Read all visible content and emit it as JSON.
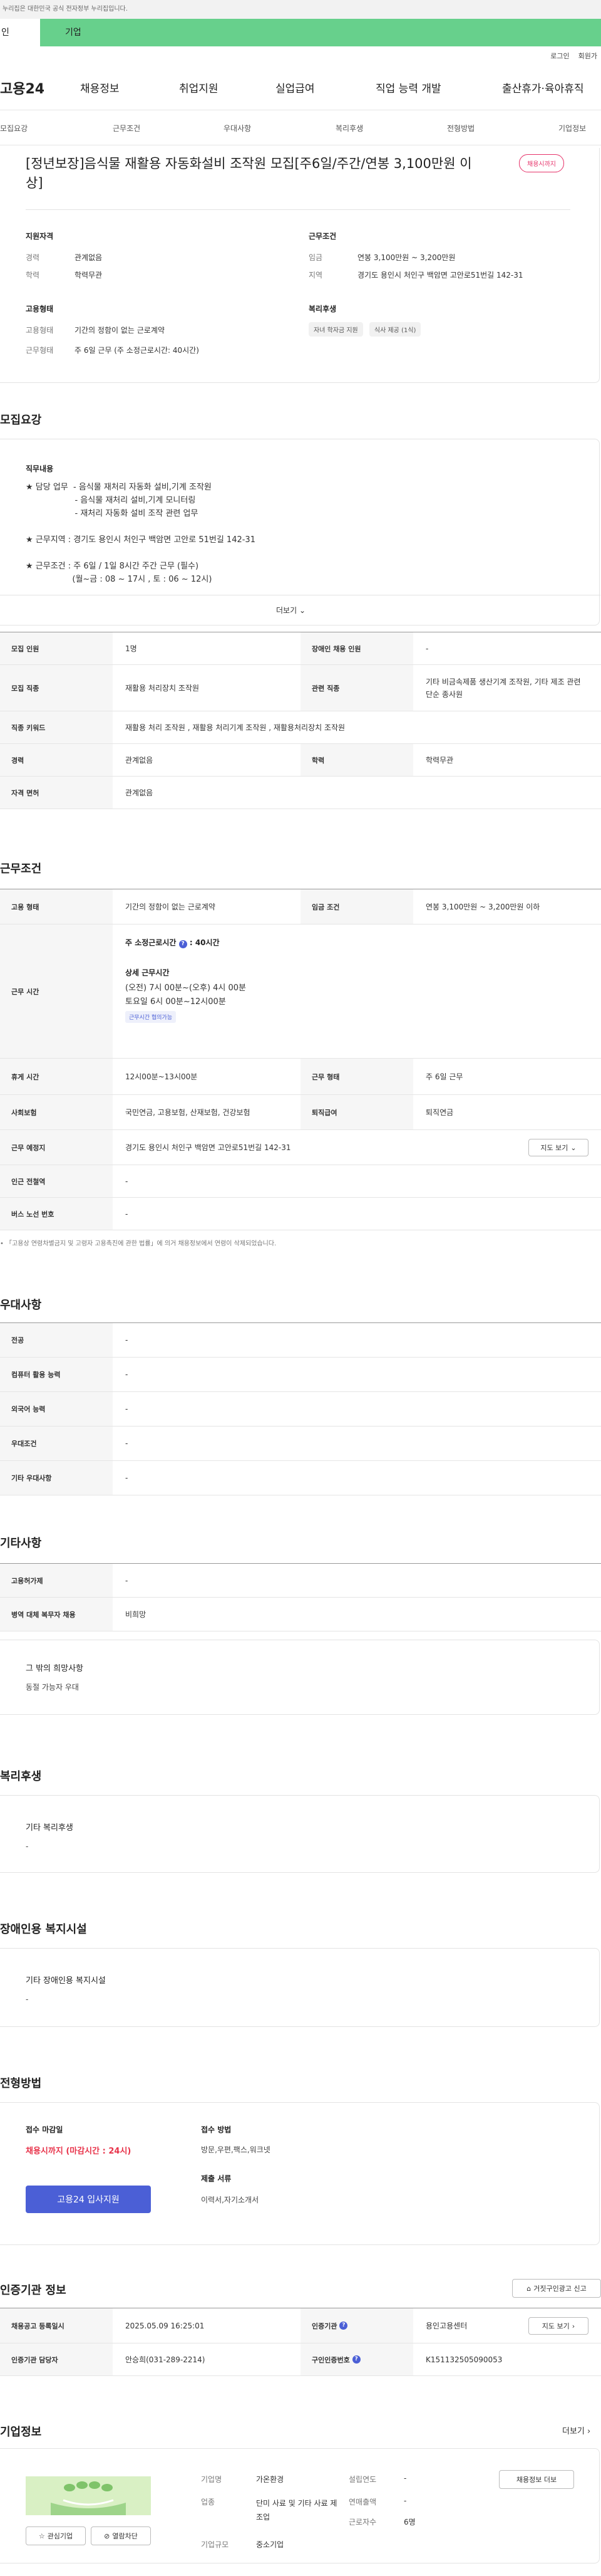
{
  "top_notice": "누리집은 대한민국 공식 전자정부 누리집입니다.",
  "user_tabs": [
    "인",
    "기업"
  ],
  "util": [
    "로그인",
    "회원가"
  ],
  "logo": "고용24",
  "gnb": [
    "채용정보",
    "취업지원",
    "실업급여",
    "직업 능력 개발",
    "출산휴가·육아휴직"
  ],
  "subnav": [
    "모집요강",
    "근무조건",
    "우대사항",
    "복리후생",
    "전형방법",
    "기업정보"
  ],
  "job": {
    "title": "[정년보장]음식물 재활용 자동화설비 조작원 모집[주6일/주간/연봉 3,100만원 이상]",
    "status": "채용시까지"
  },
  "summary": {
    "qual_title": "지원자격",
    "exp_label": "경력",
    "exp": "관계없음",
    "edu_label": "학력",
    "edu": "학력무관",
    "emp_title": "고용형태",
    "emptype_label": "고용형태",
    "emptype": "기간의 정함이 없는 근로계약",
    "worktype_label": "근무형태",
    "worktype": "주 6일 근무 (주 소정근로시간: 40시간)",
    "cond_title": "근무조건",
    "wage_label": "임금",
    "wage": "연봉 3,100만원 ~ 3,200만원",
    "region_label": "지역",
    "region": "경기도 용인시 처인구 백암면 고안로51번길 142-31",
    "welfare_title": "복리후생",
    "chips": [
      "자녀 학자금 지원",
      "식사 제공 (1식)"
    ]
  },
  "recruit": {
    "heading": "모집요강",
    "duty_title": "직무내용",
    "duty_text": "★ 담당 업무  - 음식물 재처리 자동화 설비,기계 조작원\n                   - 음식물 재처리 설비,기계 모니터링\n                   - 재처리 자동화 설비 조작 관련 업무\n\n★ 근무지역 : 경기도 용인시 처인구 백암면 고안로 51번길 142-31\n\n★ 근무조건 : 주 6일 / 1일 8시간 주간 근무 (필수)\n                  (월~금 : 08 ~ 17시 , 토 : 06 ~ 12시)",
    "more": "더보기",
    "rows": [
      {
        "k1": "모집 인원",
        "v1": "1명",
        "k2": "장애인 채용 인원",
        "v2": "-"
      },
      {
        "k1": "모집 직종",
        "v1": "재활용 처리장치 조작원",
        "k2": "관련 직종",
        "v2": "기타 비금속제품 생산기계 조작원, 기타 제조 관련 단순 종사원"
      },
      {
        "k1": "직종 키워드",
        "v1": "재활용 처리 조작원 , 재활용 처리기계 조작원 , 재활용처리장치 조작원"
      },
      {
        "k1": "경력",
        "v1": "관계없음",
        "k2": "학력",
        "v2": "학력무관"
      },
      {
        "k1": "자격 면허",
        "v1": "관계없음"
      }
    ]
  },
  "conditions": {
    "heading": "근무조건",
    "emp_k": "고용 형태",
    "emp_v": "기간의 정함이 없는 근로계약",
    "wage_k": "임금 조건",
    "wage_v": "연봉 3,100만원 ~ 3,200만원 이하",
    "time_k": "근무 시간",
    "time_main": "주 소정근로시간",
    "time_main_val": ": 40시간",
    "time_detail_title": "상세 근무시간",
    "time_detail1": "(오전) 7시 00분~(오후) 4시 00분",
    "time_detail2": "토요일 6시 00분~12시00분",
    "time_badge": "근무시간 협의가능",
    "break_k": "휴게 시간",
    "break_v": "12시00분~13시00분",
    "type_k": "근무 형태",
    "type_v": "주 6일 근무",
    "ins_k": "사회보험",
    "ins_v": "국민연금, 고용보험, 산재보험, 건강보험",
    "sev_k": "퇴직급여",
    "sev_v": "퇴직연금",
    "place_k": "근무 예정지",
    "place_v": "경기도 용인시 처인구 백암면 고안로51번길 142-31",
    "map_btn": "지도 보기",
    "subway_k": "인근 전철역",
    "subway_v": "-",
    "bus_k": "버스 노선 번호",
    "bus_v": "-",
    "note": "「고용상 연령차별금지 및 고령자 고용촉진에 관한 법률」에 의거 채용정보에서 연령이 삭제되었습니다."
  },
  "preference": {
    "heading": "우대사항",
    "rows": [
      {
        "k": "전공",
        "v": "-"
      },
      {
        "k": "컴퓨터 활용 능력",
        "v": "-"
      },
      {
        "k": "외국어 능력",
        "v": "-"
      },
      {
        "k": "우대조건",
        "v": "-"
      },
      {
        "k": "기타 우대사항",
        "v": "-"
      }
    ]
  },
  "etc": {
    "heading": "기타사항",
    "rows": [
      {
        "k": "고용허가제",
        "v": "-"
      },
      {
        "k": "병역 대체 복무자 채용",
        "v": "비희망"
      }
    ],
    "box_title": "그 밖의 희망사항",
    "box_text": "동절 가능자 우대"
  },
  "welfare": {
    "heading": "복리후생",
    "box_title": "기타 복리후생",
    "box_text": "-"
  },
  "disabled": {
    "heading": "장애인용 복지시설",
    "box_title": "기타 장애인용 복지시설",
    "box_text": "-"
  },
  "process": {
    "heading": "전형방법",
    "deadline_title": "접수 마감일",
    "deadline": "채용시까지 (마감시간 : 24시)",
    "apply_btn": "고용24 입사지원",
    "method_title": "접수 방법",
    "method": "방문,우편,팩스,워크넷",
    "docs_title": "제출 서류",
    "docs": "이력서,자기소개서"
  },
  "cert": {
    "heading": "인증기관 정보",
    "report_btn": "거짓구인광고 신고",
    "reg_k": "채용공고 등록일시",
    "reg_v": "2025.05.09 16:25:01",
    "org_k": "인증기관",
    "org_v": "용인고용센터",
    "map_btn": "지도 보기",
    "mgr_k": "인증기관 담당자",
    "mgr_v": "안승희(031-289-2214)",
    "no_k": "구인인증번호",
    "no_v": "K151132505090053"
  },
  "company": {
    "heading": "기업정보",
    "more": "더보기",
    "fav_btn": "관심기업",
    "block_btn": "열람차단",
    "name_k": "기업명",
    "name_v": "가온환경",
    "ind_k": "업종",
    "ind_v": "단미 사료 및 기타 사료 제조업",
    "size_k": "기업규모",
    "size_v": "중소기업",
    "est_k": "설립연도",
    "est_v": "-",
    "sales_k": "연매출액",
    "sales_v": "-",
    "emp_k": "근로자수",
    "emp_v": "6명",
    "jobs_btn": "채용정보 더보"
  },
  "colors": {
    "green_tab": "#67d08c",
    "apply_btn": "#4b5fd6",
    "deadline_red": "#e8334a",
    "badge_pink": "#e6336a"
  }
}
